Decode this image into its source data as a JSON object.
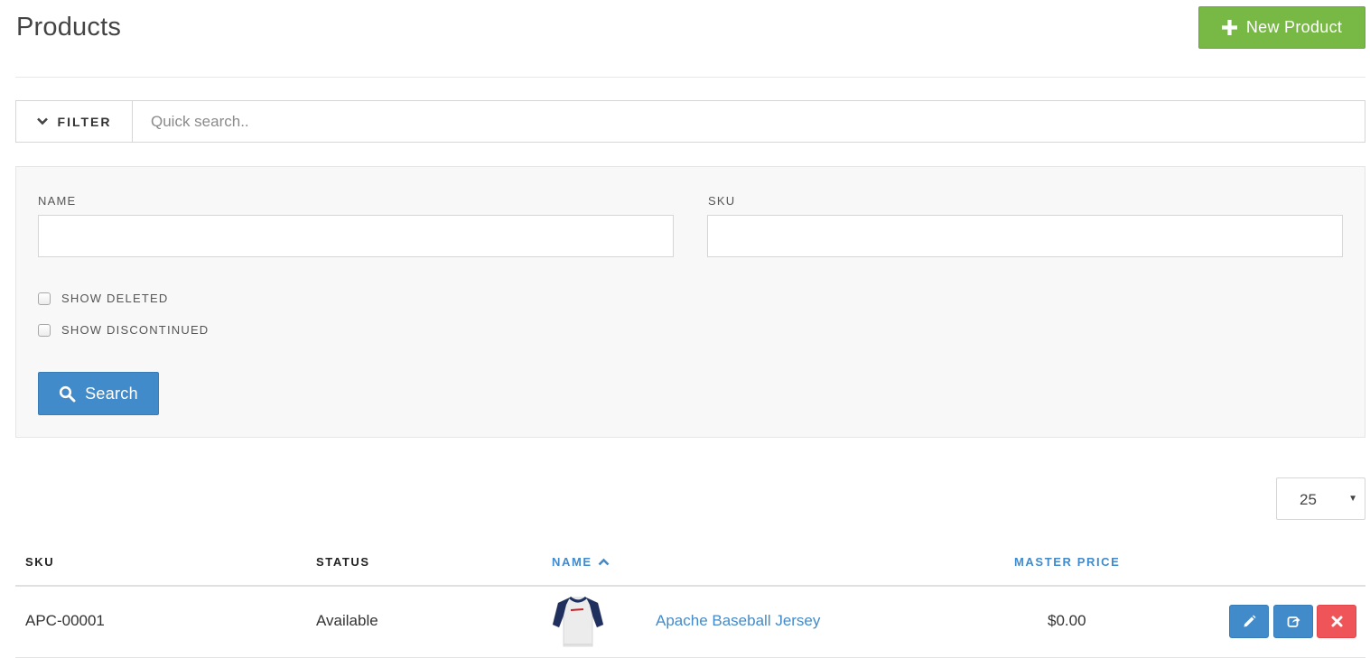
{
  "header": {
    "title": "Products",
    "new_button_label": "New Product"
  },
  "filter_bar": {
    "toggle_label": "FILTER",
    "quick_search_placeholder": "Quick search..",
    "quick_search_value": ""
  },
  "filters": {
    "name_label": "NAME",
    "name_value": "",
    "sku_label": "SKU",
    "sku_value": "",
    "show_deleted_label": "SHOW DELETED",
    "show_deleted_checked": false,
    "show_discontinued_label": "SHOW DISCONTINUED",
    "show_discontinued_checked": false,
    "search_button_label": "Search"
  },
  "pagination": {
    "per_page": "25"
  },
  "table": {
    "columns": {
      "sku": "SKU",
      "status": "STATUS",
      "name": "NAME",
      "master_price": "MASTER PRICE"
    },
    "sort": {
      "column": "name",
      "direction": "ascending"
    },
    "rows": [
      {
        "sku": "APC-00001",
        "status": "Available",
        "thumbnail": "baseball-jersey-image",
        "name": "Apache Baseball Jersey",
        "master_price": "$0.00"
      }
    ]
  },
  "colors": {
    "primary": "#428bca",
    "success": "#78b844",
    "danger": "#ef5458",
    "panel_bg": "#f8f8f8"
  },
  "icons": {
    "new_button": "plus-icon",
    "filter_toggle": "chevron-down-icon",
    "search_button": "search-icon",
    "sort_indicator": "chevron-up-icon",
    "edit_action": "pencil-icon",
    "clone_action": "share-icon",
    "delete_action": "close-icon"
  }
}
